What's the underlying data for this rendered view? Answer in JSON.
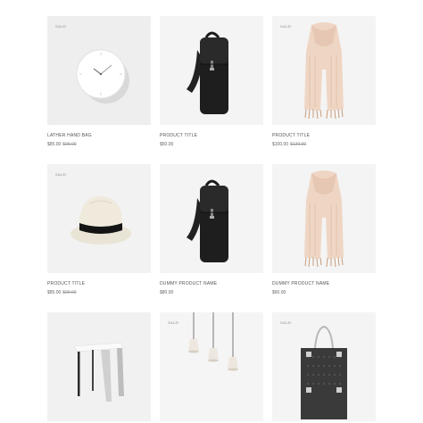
{
  "products": [
    {
      "badge": "SALE!",
      "title": "LATHER HAND BAG",
      "price": "$85.00",
      "old_price": "$99.00",
      "image": "wall-clock"
    },
    {
      "badge": "",
      "title": "PRODUCT TITLE",
      "price": "$50.00",
      "old_price": "",
      "image": "black-backpack"
    },
    {
      "badge": "SALE!",
      "title": "PRODUCT TITLE",
      "price": "$100.00",
      "old_price": "$120.00",
      "image": "beige-scarf"
    },
    {
      "badge": "SALE!",
      "title": "PRODUCT TITLE",
      "price": "$85.00",
      "old_price": "$99.00",
      "image": "straw-hat"
    },
    {
      "badge": "",
      "title": "DUMMY PRODUCT NAME",
      "price": "$80.00",
      "old_price": "",
      "image": "black-backpack"
    },
    {
      "badge": "",
      "title": "DUMMY PRODUCT NAME",
      "price": "$60.00",
      "old_price": "",
      "image": "beige-scarf"
    },
    {
      "badge": "",
      "title": "",
      "price": "",
      "old_price": "",
      "image": "white-stool"
    },
    {
      "badge": "SALE!",
      "title": "",
      "price": "",
      "old_price": "",
      "image": "pendant-lamps"
    },
    {
      "badge": "SALE!",
      "title": "",
      "price": "",
      "old_price": "",
      "image": "tote-bag"
    }
  ]
}
